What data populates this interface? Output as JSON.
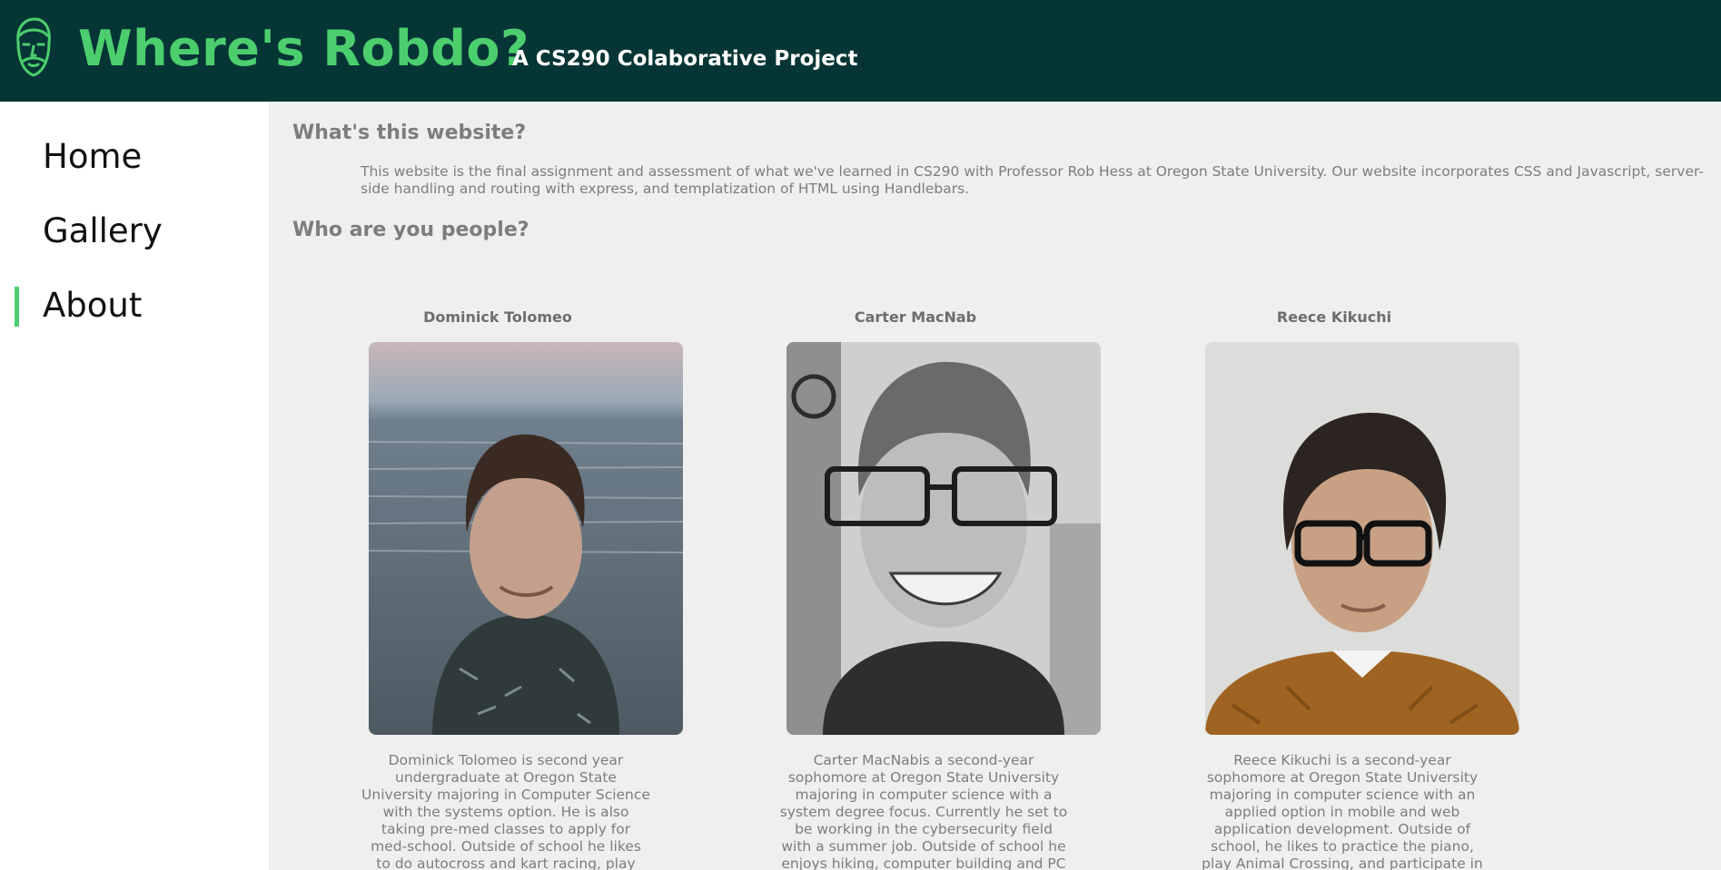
{
  "header": {
    "title": "Where's Robdo?",
    "subtitle": "A CS290 Colaborative Project",
    "logo_icon": "bearded-face-icon",
    "bg_color": "#053635",
    "accent_color": "#4cce6e"
  },
  "sidebar": {
    "items": [
      {
        "label": "Home",
        "active": false
      },
      {
        "label": "Gallery",
        "active": false
      },
      {
        "label": "About",
        "active": true
      }
    ]
  },
  "main": {
    "intro_heading": "What's this website?",
    "intro_text": "This website is the final assignment and assessment of what we've learned in CS290 with Professor Rob Hess at Oregon State University. Our website incorporates CSS and Javascript, server-side handling and routing with express, and templatization of HTML using Handlebars.",
    "people_heading": "Who are you people?",
    "people": [
      {
        "name": "Dominick Tolomeo",
        "bio": "Dominick Tolomeo is second year undergraduate at Oregon State University majoring in Computer Science with the systems option. He is also taking pre-med classes to apply for med-school. Outside of school he likes to do autocross and kart racing, play video games, and snowboard."
      },
      {
        "name": "Carter MacNab",
        "bio": "Carter MacNabis a second-year sophomore at Oregon State University majoring in computer science with a system degree focus. Currently he set to be working in the cybersecurity field with a summer job. Outside of school he enjoys hiking, computer building and PC gaming as some of his current hobies."
      },
      {
        "name": "Reece Kikuchi",
        "bio": "Reece Kikuchi is a second-year sophomore at Oregon State University majoring in computer science with an applied option in mobile and web application development. Outside of school, he likes to practice the piano, play Animal Crossing, and participate in student activism."
      }
    ]
  }
}
